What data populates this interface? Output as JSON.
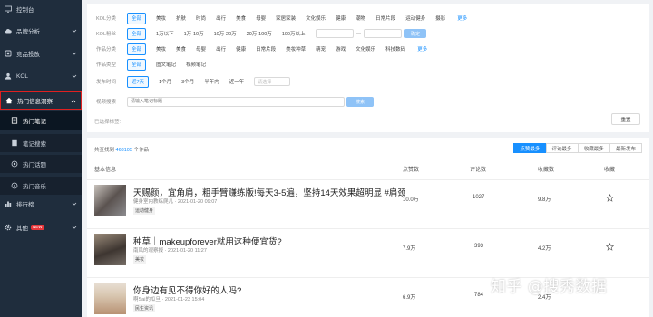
{
  "sidebar": {
    "items": [
      {
        "label": "控制台",
        "icon": "monitor-icon"
      },
      {
        "label": "品牌分析",
        "icon": "cloud-icon"
      },
      {
        "label": "竞品投放",
        "icon": "box-icon"
      },
      {
        "label": "KOL",
        "icon": "user-icon"
      },
      {
        "label": "热门信息洞察",
        "icon": "home-icon"
      },
      {
        "label": "排行榜",
        "icon": "rank-icon"
      },
      {
        "label": "其他",
        "icon": "gear-icon",
        "badge": "NEW"
      }
    ],
    "sub_items": [
      {
        "label": "热门笔记"
      },
      {
        "label": "笔记搜索"
      },
      {
        "label": "热门话题"
      },
      {
        "label": "热门音乐"
      }
    ]
  },
  "filters": {
    "kol_category": {
      "label": "KOL分类",
      "options": [
        "全部",
        "美妆",
        "护肤",
        "时尚",
        "出行",
        "美食",
        "母婴",
        "家居家装",
        "文化娱乐",
        "健康",
        "潮物",
        "日常片段",
        "运动健身",
        "摄影"
      ],
      "more": "更多"
    },
    "kol_fans": {
      "label": "KOL粉丝",
      "options": [
        "全部",
        "1万以下",
        "1万-10万",
        "10万-20万",
        "20万-100万",
        "100万以上"
      ],
      "sep": "—",
      "confirm": "确定"
    },
    "note_category": {
      "label": "作品分类",
      "options": [
        "全部",
        "美妆",
        "美食",
        "母婴",
        "出行",
        "健康",
        "日常片段",
        "美妆种草",
        "萌宠",
        "游戏",
        "文化娱乐",
        "科技数码"
      ],
      "more": "更多"
    },
    "note_type": {
      "label": "作品类型",
      "options": [
        "全部",
        "图文笔记",
        "视频笔记"
      ]
    },
    "publish_time": {
      "label": "发布时间",
      "options": [
        "近7天",
        "1个月",
        "3个月",
        "半年内",
        "近一年"
      ],
      "date_placeholder": "请选择"
    },
    "keyword": {
      "label": "视频搜索",
      "placeholder": "请输入笔记标题",
      "button": "搜索"
    },
    "selected_label": "已选择标签:",
    "reset": "重置"
  },
  "results": {
    "total_prefix": "共查找到",
    "total_num": "463105",
    "total_suffix": "个作品",
    "sort_buttons": [
      "点赞最多",
      "评论最多",
      "收藏最多",
      "最新发布"
    ],
    "columns": [
      "基本信息",
      "点赞数",
      "评论数",
      "收藏数",
      "收藏"
    ],
    "rows": [
      {
        "title": "天赐颜，宜角肩，粗手臂赚练版!每天3-5遍，坚持14天效果超明显 #肩颈...",
        "author": "健身室内教练爬儿",
        "date": "2021-01-20 09:07",
        "tag": "运动健身",
        "likes": "10.0万",
        "comments": "1027",
        "collects": "9.8万",
        "thumb_colors": [
          "#c9c3bd",
          "#5b5350",
          "#8d8d90"
        ]
      },
      {
        "title": "种草｜makeupforever就用这种便宜货?",
        "author": "南风的观察报",
        "date": "2021-01-20 11:27",
        "tag": "美妆",
        "likes": "7.9万",
        "comments": "393",
        "collects": "4.2万",
        "thumb_colors": [
          "#9a8b7a",
          "#3e3631",
          "#776f68"
        ]
      },
      {
        "title": "你身边有见不得你好的人吗?",
        "author": "啊Sai的瓜旦",
        "date": "2021-01-23 15:04",
        "tag": "民生资讯",
        "likes": "6.9万",
        "comments": "784",
        "collects": "2.4万",
        "thumb_colors": [
          "#d9c7b1",
          "#b89274",
          "#e8dfd4"
        ]
      }
    ]
  },
  "watermark": "知乎 @搜秀数据",
  "colors": {
    "sidebar_bg": "#1f2d3d",
    "accent": "#1890ff",
    "highlight_border": "#e02020"
  }
}
